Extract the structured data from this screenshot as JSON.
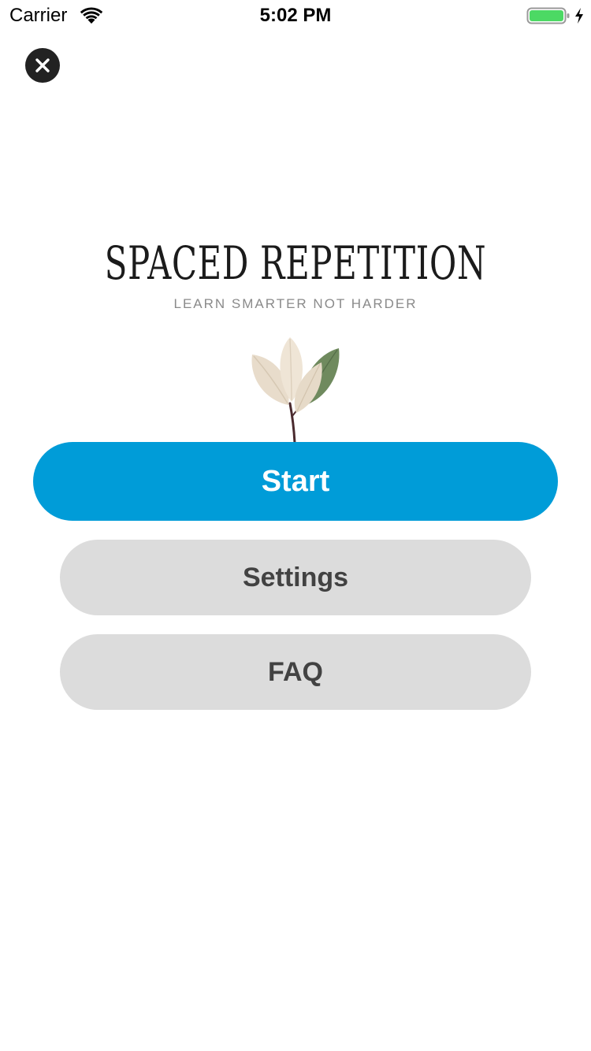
{
  "status_bar": {
    "carrier": "Carrier",
    "time": "5:02 PM",
    "wifi_icon": "wifi-icon",
    "battery_icon": "battery-charging-icon",
    "battery_color": "#4cd964"
  },
  "header": {
    "close_icon": "close-icon"
  },
  "branding": {
    "title": "SPACED REPETITION",
    "tagline": "LEARN SMARTER NOT HARDER",
    "illustration": "plant-leaves-illustration"
  },
  "menu": {
    "start_label": "Start",
    "settings_label": "Settings",
    "faq_label": "FAQ"
  },
  "colors": {
    "primary_button": "#009cd8",
    "secondary_button": "#dcdcdc",
    "secondary_text": "#424242",
    "tagline_text": "#8a8a8a"
  }
}
